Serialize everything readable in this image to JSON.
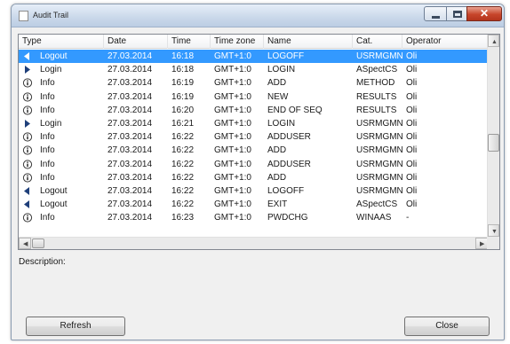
{
  "window": {
    "title": "Audit Trail",
    "close_glyph": "✕"
  },
  "columns": [
    "Type",
    "Date",
    "Time",
    "Time zone",
    "Name",
    "Cat.",
    "Operator"
  ],
  "rows": [
    {
      "type": "Logout",
      "icon": "logout-icon",
      "date": "27.03.2014",
      "time": "16:18",
      "tz": "GMT+1:0",
      "name": "LOGOFF",
      "cat": "USRMGMN",
      "op": "Oli",
      "selected": true
    },
    {
      "type": "Login",
      "icon": "login-icon",
      "date": "27.03.2014",
      "time": "16:18",
      "tz": "GMT+1:0",
      "name": "LOGIN",
      "cat": "ASpectCS",
      "op": "Oli"
    },
    {
      "type": "Info",
      "icon": "info-icon",
      "date": "27.03.2014",
      "time": "16:19",
      "tz": "GMT+1:0",
      "name": "ADD",
      "cat": "METHOD",
      "op": "Oli"
    },
    {
      "type": "Info",
      "icon": "info-icon",
      "date": "27.03.2014",
      "time": "16:19",
      "tz": "GMT+1:0",
      "name": "NEW",
      "cat": "RESULTS",
      "op": "Oli"
    },
    {
      "type": "Info",
      "icon": "info-icon",
      "date": "27.03.2014",
      "time": "16:20",
      "tz": "GMT+1:0",
      "name": "END OF SEQ",
      "cat": "RESULTS",
      "op": "Oli"
    },
    {
      "type": "Login",
      "icon": "login-icon",
      "date": "27.03.2014",
      "time": "16:21",
      "tz": "GMT+1:0",
      "name": "LOGIN",
      "cat": "USRMGMN",
      "op": "Oli"
    },
    {
      "type": "Info",
      "icon": "info-icon",
      "date": "27.03.2014",
      "time": "16:22",
      "tz": "GMT+1:0",
      "name": "ADDUSER",
      "cat": "USRMGMN",
      "op": "Oli"
    },
    {
      "type": "Info",
      "icon": "info-icon",
      "date": "27.03.2014",
      "time": "16:22",
      "tz": "GMT+1:0",
      "name": "ADD",
      "cat": "USRMGMN",
      "op": "Oli"
    },
    {
      "type": "Info",
      "icon": "info-icon",
      "date": "27.03.2014",
      "time": "16:22",
      "tz": "GMT+1:0",
      "name": "ADDUSER",
      "cat": "USRMGMN",
      "op": "Oli"
    },
    {
      "type": "Info",
      "icon": "info-icon",
      "date": "27.03.2014",
      "time": "16:22",
      "tz": "GMT+1:0",
      "name": "ADD",
      "cat": "USRMGMN",
      "op": "Oli"
    },
    {
      "type": "Logout",
      "icon": "logout-icon",
      "date": "27.03.2014",
      "time": "16:22",
      "tz": "GMT+1:0",
      "name": "LOGOFF",
      "cat": "USRMGMN",
      "op": "Oli"
    },
    {
      "type": "Logout",
      "icon": "logout-icon",
      "date": "27.03.2014",
      "time": "16:22",
      "tz": "GMT+1:0",
      "name": "EXIT",
      "cat": "ASpectCS",
      "op": "Oli"
    },
    {
      "type": "Info",
      "icon": "info-icon",
      "date": "27.03.2014",
      "time": "16:23",
      "tz": "GMT+1:0",
      "name": "PWDCHG",
      "cat": "WINAAS",
      "op": "-"
    }
  ],
  "description": {
    "label": "Description:",
    "text": ""
  },
  "buttons": {
    "refresh": "Refresh",
    "close": "Close"
  },
  "colors": {
    "selection": "#3399ff",
    "window_bg": "#f0f0f0"
  }
}
